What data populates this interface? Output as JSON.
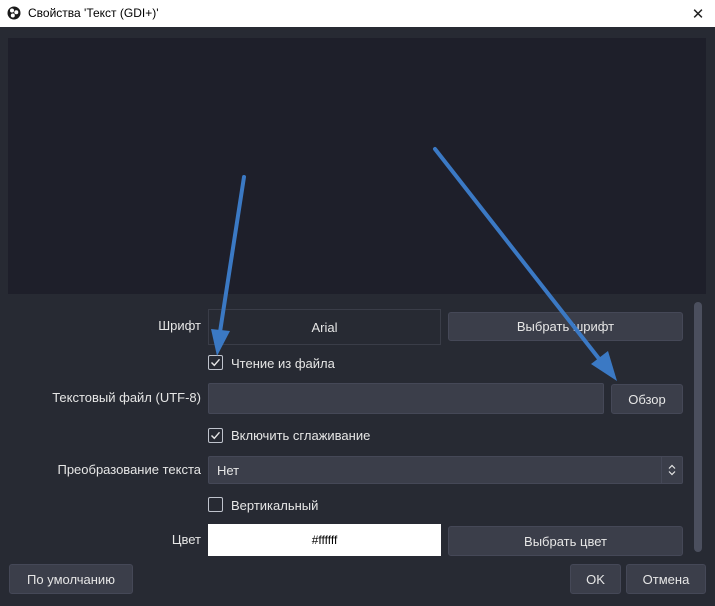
{
  "window": {
    "title": "Свойства 'Текст (GDI+)'",
    "close_symbol": "✕"
  },
  "properties": {
    "font": {
      "label": "Шрифт",
      "value": "Arial",
      "button": "Выбрать шрифт"
    },
    "read_from_file": {
      "label": "Чтение из файла",
      "checked": true
    },
    "text_file": {
      "label": "Текстовый файл (UTF-8)",
      "value": "",
      "button": "Обзор"
    },
    "antialiasing": {
      "label": "Включить сглаживание",
      "checked": true
    },
    "transform": {
      "label": "Преобразование текста",
      "value": "Нет"
    },
    "vertical": {
      "label": "Вертикальный",
      "checked": false
    },
    "color": {
      "label": "Цвет",
      "value": "#ffffff",
      "button": "Выбрать цвет"
    }
  },
  "footer": {
    "defaults": "По умолчанию",
    "ok": "OK",
    "cancel": "Отмена"
  },
  "colors": {
    "accent_arrow": "#3b79c4",
    "background": "#272a33",
    "preview": "#1e1f2a"
  }
}
